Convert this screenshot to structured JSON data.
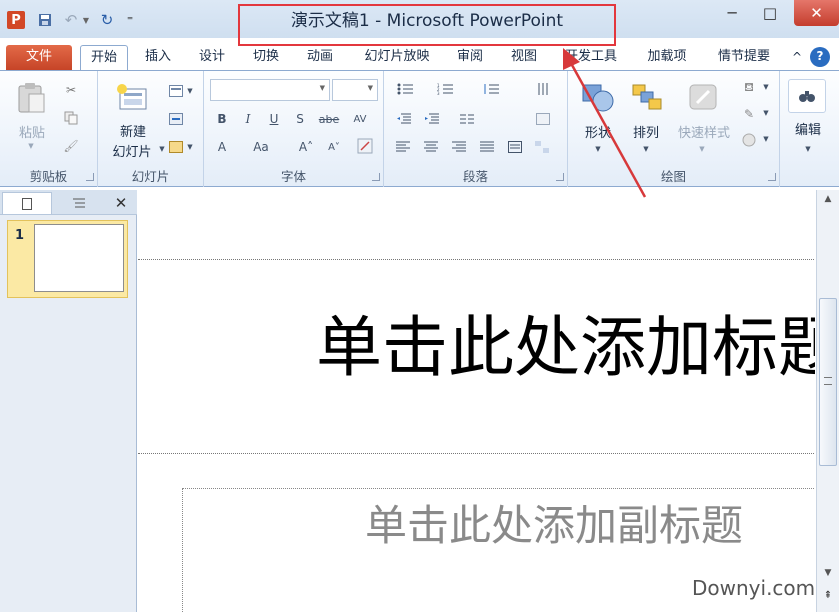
{
  "window": {
    "title": "演示文稿1 - Microsoft PowerPoint",
    "app_logo": "P",
    "qat": {
      "undo": "↶",
      "redo": "↻",
      "customize": "⁼"
    },
    "controls": {
      "minimize": "─",
      "maximize": "□",
      "close": "✕"
    }
  },
  "tabs": [
    {
      "label": "文件"
    },
    {
      "label": "开始"
    },
    {
      "label": "插入"
    },
    {
      "label": "设计"
    },
    {
      "label": "切换"
    },
    {
      "label": "动画"
    },
    {
      "label": "幻灯片放映"
    },
    {
      "label": "审阅"
    },
    {
      "label": "视图"
    },
    {
      "label": "开发工具"
    },
    {
      "label": "加载项"
    },
    {
      "label": "情节提要"
    }
  ],
  "tabs_right": {
    "collapse": "^",
    "help": "?"
  },
  "ribbon": {
    "clipboard": {
      "label": "剪贴板",
      "paste": "粘贴"
    },
    "slides": {
      "label": "幻灯片",
      "new_slide_line1": "新建",
      "new_slide_line2": "幻灯片"
    },
    "font": {
      "label": "字体",
      "buttons": [
        "B",
        "I",
        "U",
        "S",
        "abe",
        "AV",
        "A",
        "Aa",
        "A˄",
        "A˅"
      ]
    },
    "paragraph": {
      "label": "段落"
    },
    "drawing": {
      "label": "绘图",
      "shapes": "形状",
      "arrange": "排列",
      "quick_styles": "快速样式"
    },
    "editing": {
      "label": "编辑",
      "edit": "编辑"
    }
  },
  "slides_panel": {
    "slide_number": "1",
    "close": "✕"
  },
  "slide": {
    "title_placeholder": "单击此处添加标题",
    "subtitle_placeholder": "单击此处添加副标题"
  },
  "watermark": "Downyi.com",
  "colors": {
    "file_tab": "#c64427",
    "highlight_border": "#e3373d",
    "arrow": "#d7393b"
  }
}
